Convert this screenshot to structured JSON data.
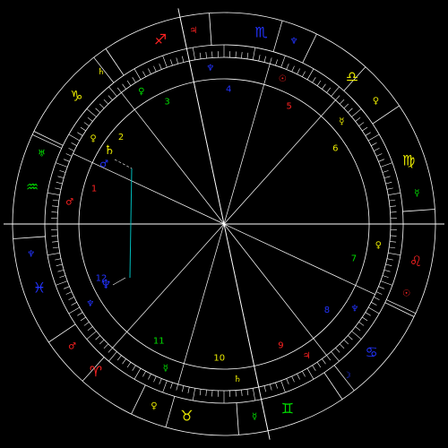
{
  "signs": [
    {
      "name": "scorpio-sign",
      "glyph": "♏",
      "color": "#2233ff"
    },
    {
      "name": "libra-sign",
      "glyph": "♎",
      "color": "#e8e800"
    },
    {
      "name": "virgo-sign",
      "glyph": "♍",
      "color": "#e8e800"
    },
    {
      "name": "leo-sign",
      "glyph": "♌",
      "color": "#ff2222"
    },
    {
      "name": "cancer-sign",
      "glyph": "♋",
      "color": "#2233ff"
    },
    {
      "name": "gemini-sign",
      "glyph": "♊",
      "color": "#00dd00"
    },
    {
      "name": "taurus-sign",
      "glyph": "♉",
      "color": "#e8e800"
    },
    {
      "name": "aries-sign",
      "glyph": "♈",
      "color": "#ff2222"
    },
    {
      "name": "pisces-sign",
      "glyph": "♓",
      "color": "#2233ff"
    },
    {
      "name": "aquarius-sign",
      "glyph": "♒",
      "color": "#00dd00"
    },
    {
      "name": "capricorn-sign",
      "glyph": "♑",
      "color": "#e8e800"
    },
    {
      "name": "sagittarius-sign",
      "glyph": "♐",
      "color": "#ff2222"
    }
  ],
  "sign_rulers": [
    {
      "name": "pluto-ruler",
      "glyph": "♆",
      "color": "#2233ff"
    },
    {
      "name": "venus-ruler",
      "glyph": "♀",
      "color": "#e8e800"
    },
    {
      "name": "mercury-ruler",
      "glyph": "☿",
      "color": "#00dd00"
    },
    {
      "name": "sun-ruler",
      "glyph": "☉",
      "color": "#ff2222"
    },
    {
      "name": "moon-ruler",
      "glyph": "☽",
      "color": "#2233ff"
    },
    {
      "name": "mercury-ruler",
      "glyph": "☿",
      "color": "#00dd00"
    },
    {
      "name": "venus-ruler",
      "glyph": "♀",
      "color": "#e8e800"
    },
    {
      "name": "mars-ruler",
      "glyph": "♂",
      "color": "#ff2222"
    },
    {
      "name": "neptune-ruler",
      "glyph": "♆",
      "color": "#2233ff"
    },
    {
      "name": "uranus-ruler",
      "glyph": "♅",
      "color": "#00dd00"
    },
    {
      "name": "saturn-ruler",
      "glyph": "♄",
      "color": "#e8e800"
    },
    {
      "name": "jupiter-ruler",
      "glyph": "♃",
      "color": "#ff2222"
    }
  ],
  "house_numbers": [
    {
      "label": "1",
      "color": "#ff2222"
    },
    {
      "label": "2",
      "color": "#e8e800"
    },
    {
      "label": "3",
      "color": "#00dd00"
    },
    {
      "label": "4",
      "color": "#2233ff"
    },
    {
      "label": "5",
      "color": "#ff2222"
    },
    {
      "label": "6",
      "color": "#e8e800"
    },
    {
      "label": "7",
      "color": "#00dd00"
    },
    {
      "label": "8",
      "color": "#2233ff"
    },
    {
      "label": "9",
      "color": "#ff2222"
    },
    {
      "label": "10",
      "color": "#e8e800"
    },
    {
      "label": "11",
      "color": "#00dd00"
    },
    {
      "label": "12",
      "color": "#2233ff"
    }
  ],
  "house_rulers": [
    {
      "name": "mars-house-ruler",
      "glyph": "♂",
      "color": "#ff2222"
    },
    {
      "name": "venus-house-ruler",
      "glyph": "♀",
      "color": "#e8e800"
    },
    {
      "name": "venus-house-ruler",
      "glyph": "♀",
      "color": "#00dd00"
    },
    {
      "name": "neptune-house-ruler",
      "glyph": "♆",
      "color": "#2233ff"
    },
    {
      "name": "sun-house-ruler",
      "glyph": "☉",
      "color": "#ff2222"
    },
    {
      "name": "mercury-house-ruler",
      "glyph": "☿",
      "color": "#e8e800"
    },
    {
      "name": "venus-house-ruler",
      "glyph": "♀",
      "color": "#e8e800"
    },
    {
      "name": "pluto-house-ruler",
      "glyph": "♆",
      "color": "#2233ff"
    },
    {
      "name": "jupiter-house-ruler",
      "glyph": "♃",
      "color": "#ff2222"
    },
    {
      "name": "saturn-house-ruler",
      "glyph": "♄",
      "color": "#e8e800"
    },
    {
      "name": "mercury-house-ruler",
      "glyph": "☿",
      "color": "#00dd00"
    },
    {
      "name": "neptune-house-ruler",
      "glyph": "♆",
      "color": "#2233ff"
    }
  ],
  "planets": [
    {
      "name": "saturn-planet",
      "glyph": "♄",
      "color": "#e8e800"
    },
    {
      "name": "mars-planet",
      "glyph": "♂",
      "color": "#2233ff"
    },
    {
      "name": "neptune-planet",
      "glyph": "♆",
      "color": "#2233ff"
    }
  ],
  "colors": {
    "background": "#000000",
    "lines": "#ffffff",
    "aspect": "#00bbbb"
  }
}
